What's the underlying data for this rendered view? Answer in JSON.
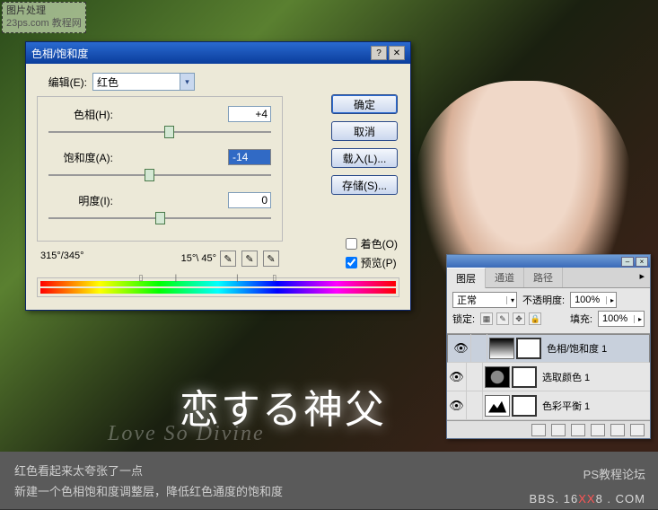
{
  "watermark": {
    "line1": "图片处理",
    "line2": "23ps.com 教程网"
  },
  "bg": {
    "title": "恋する神父",
    "subtitle": "Love So Divine"
  },
  "dialog": {
    "title": "色相/饱和度",
    "edit_label": "编辑(E):",
    "edit_value": "红色",
    "hue_label": "色相(H):",
    "hue_value": "+4",
    "sat_label": "饱和度(A):",
    "sat_value": "-14",
    "light_label": "明度(I):",
    "light_value": "0",
    "range_left": "315°/345°",
    "range_right": "15°\\ 45°",
    "colorize_label": "着色(O)",
    "preview_label": "预览(P)",
    "btn_ok": "确定",
    "btn_cancel": "取消",
    "btn_load": "载入(L)...",
    "btn_save": "存储(S)..."
  },
  "panel": {
    "tabs": [
      "图层",
      "通道",
      "路径"
    ],
    "blend_label": "正常",
    "opacity_label": "不透明度:",
    "opacity_val": "100%",
    "lock_label": "锁定:",
    "fill_label": "填充:",
    "fill_val": "100%",
    "layers": [
      {
        "name": "色相/饱和度 1"
      },
      {
        "name": "选取颜色 1"
      },
      {
        "name": "色彩平衡 1"
      }
    ]
  },
  "caption": {
    "line1": "红色看起来太夸张了一点",
    "line2": "新建一个色相饱和度调整层，降低红色通度的饱和度",
    "right1": "PS教程论坛",
    "right2a": "BBS. 16",
    "right2b": "XX",
    "right2c": "8 . COM"
  }
}
